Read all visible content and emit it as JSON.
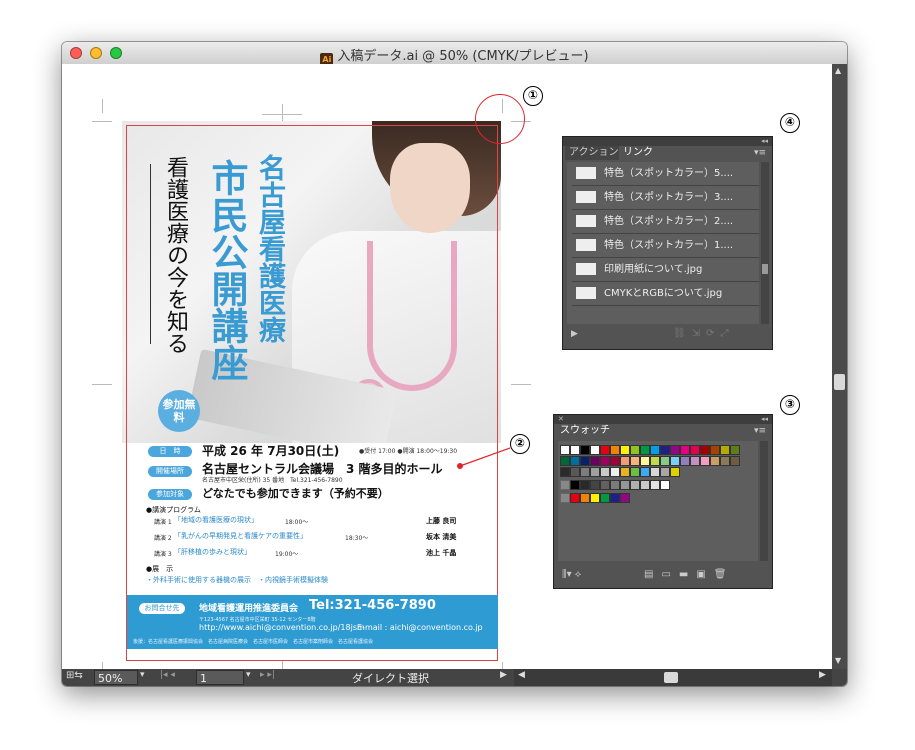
{
  "window": {
    "title": "入稿データ.ai @ 50% (CMYK/プレビュー)",
    "app_icon": "Ai",
    "status": {
      "zoom": "50%",
      "page": "1",
      "tool": "ダイレクト選択"
    }
  },
  "annotations": {
    "one": "①",
    "two": "②",
    "three": "③",
    "four": "④"
  },
  "poster": {
    "title_main": "市民公開講座",
    "title_org": "名古屋看護医療",
    "subtitle": "看護医療の今を知る",
    "badge": "参加無料",
    "rows": [
      {
        "pill": "日　時",
        "text": "平成 26 年 7月30日(土)",
        "extra": "●受付 17:00 ●開演 18:00〜19:30"
      },
      {
        "pill": "開催場所",
        "text": "名古屋セントラル会議場　3 階多目的ホール",
        "extra": "名古屋市中区栄(住所) 35 番地　Tel.321-456-7890"
      },
      {
        "pill": "参加対象",
        "text": "どなたでも参加できます（予約不要）",
        "extra": ""
      }
    ],
    "program_label": "●講演プログラム",
    "program": [
      {
        "label": "講演 1",
        "title": "「地域の看護医療の現状」",
        "time": "18:00〜",
        "speaker": "上藤 良司"
      },
      {
        "label": "講演 2",
        "title": "「乳がんの早期発見と看護ケアの重要性」",
        "time": "18:30〜",
        "speaker": "坂本 清美"
      },
      {
        "label": "講演 3",
        "title": "「肝移植の歩みと現状」",
        "time": "19:00〜",
        "speaker": "池上 千晶"
      }
    ],
    "exhibit_label": "●展　示",
    "exhibit_items": "・外科手術に使用する器機の展示　・内視鏡手術模擬体験",
    "footer": {
      "pill": "お問合せ先",
      "org": "地域看護運用推進委員会",
      "tel": "Tel:321-456-7890",
      "address": "〒123-4567 名古屋市中区栄町 35-12 センター8階",
      "url": "http://www.aichi@convention.co.jp/18jsm",
      "email": "E-mail : aichi@convention.co.jp",
      "sponsors": "後援：名古屋看護医療振興協会　名古屋病院医療会　名古屋市医師会　名古屋市薬剤師会　名古屋看護協会"
    }
  },
  "links_panel": {
    "tabs": [
      "アクション",
      "リンク"
    ],
    "items": [
      "特色（スポットカラー）5....",
      "特色（スポットカラー）3....",
      "特色（スポットカラー）2....",
      "特色（スポットカラー）1....",
      "印刷用紙について.jpg",
      "CMYKとRGBについて.jpg"
    ]
  },
  "swatches_panel": {
    "tab": "スウォッチ",
    "rows": [
      [
        "#ffffff",
        "#ffffff",
        "#000000",
        "#ffffff",
        "#e60012",
        "#f08300",
        "#fff100",
        "#8fc31f",
        "#009944",
        "#00a0e9",
        "#1d2088",
        "#920783",
        "#e4007f",
        "#e5004f",
        "#a40000",
        "#a84200",
        "#b7aa00",
        "#5d7e1a"
      ],
      [
        "#006837",
        "#006f9f",
        "#0b1f6b",
        "#6a005f",
        "#a0005d",
        "#a20036",
        "#f29b76",
        "#f6b37f",
        "#fff799",
        "#c3d94e",
        "#88c88a",
        "#7ecef4",
        "#8f82bc",
        "#c490bf",
        "#f19ec2",
        "#c8a063",
        "#8b7a5a",
        "#6e5b43"
      ],
      [
        "#2b2b2b",
        "#595757",
        "#7d7d7d",
        "#a0a0a0",
        "#c9c9c9",
        "#eeeeee",
        "#e6b422",
        "#6fbe44",
        "#3fa9f5",
        "#d7d7d7",
        "#a7a7a7",
        "#ddd000"
      ],
      [
        "#000000",
        "#2a2a2a",
        "#444444",
        "#616161",
        "#7a7a7a",
        "#959595",
        "#afafaf",
        "#c9c9c9",
        "#e3e3e3",
        "#ffffff"
      ],
      [
        "#e60012",
        "#f08300",
        "#fff100",
        "#009944",
        "#1d2088",
        "#920783"
      ]
    ]
  }
}
